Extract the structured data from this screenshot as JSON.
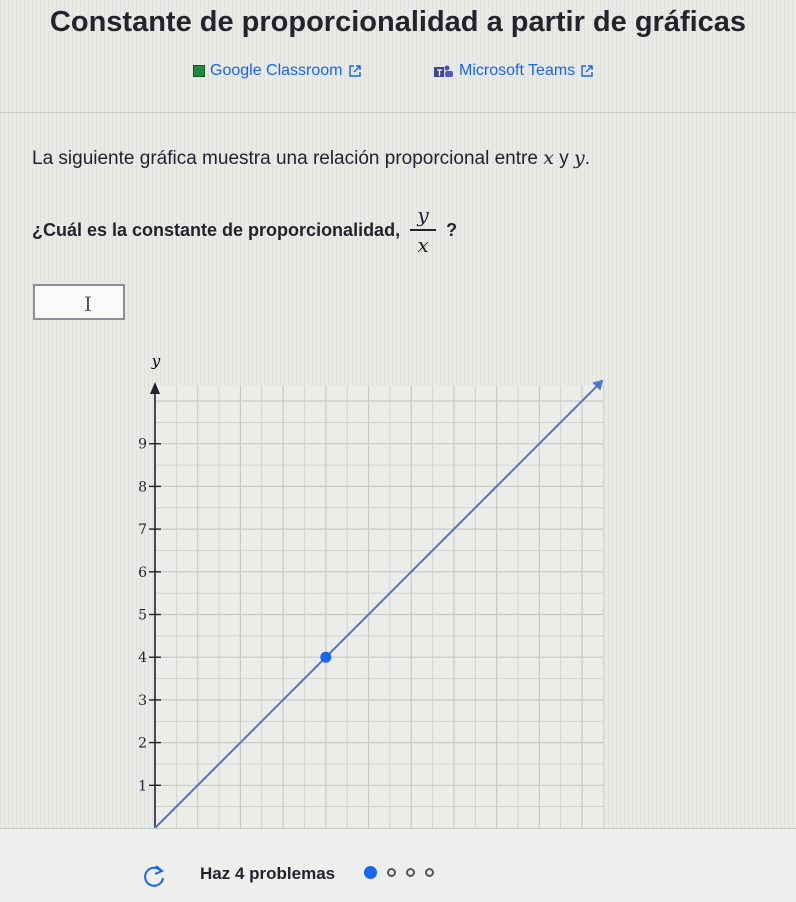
{
  "title": "Constante de proporcionalidad a partir de gráficas",
  "share": {
    "classroom": "Google Classroom",
    "teams": "Microsoft Teams"
  },
  "intro": {
    "text": "La siguiente gráfica muestra una relación proporcional entre",
    "x": "x",
    "conj": "y",
    "y": "y",
    "end": "."
  },
  "question": {
    "text": "¿Cuál es la constante de proporcionalidad,",
    "num": "y",
    "den": "x",
    "end": "?"
  },
  "answer": {
    "value": ""
  },
  "chart_data": {
    "type": "line",
    "ylabel": "y",
    "y_ticks": [
      "1",
      "2",
      "3",
      "4",
      "5",
      "6",
      "7",
      "8",
      "9"
    ],
    "ylim": [
      0,
      10.5
    ],
    "series": [
      {
        "points": [
          [
            0,
            0
          ],
          [
            10.5,
            10.5
          ]
        ]
      }
    ],
    "highlight_point": [
      4,
      4
    ],
    "colors": {
      "line": "#4f74c9",
      "point": "#1865f2",
      "grid": "#c9c9c4"
    }
  },
  "progress": {
    "label": "Haz 4 problemas",
    "total": 4,
    "current": 1
  },
  "colors": {
    "accent": "#1865f2"
  }
}
